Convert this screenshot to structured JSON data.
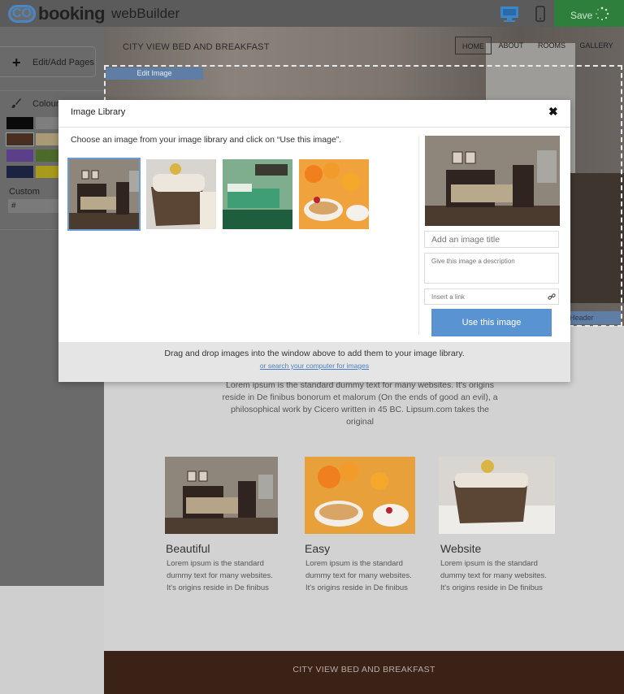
{
  "app": {
    "logo_mark": "CO",
    "logo_word": "booking",
    "logo_product": "webBuilder",
    "save_label": "Save"
  },
  "sidebar": {
    "pages_label": "Edit/Add Pages",
    "colour_label": "Colour",
    "swatches": [
      "#0a0a0a",
      "#7e7e7e",
      "#4a2e20",
      "#a79a74",
      "#5c3f8a",
      "#4c6b2a",
      "#1b2340",
      "#a89a1a"
    ],
    "custom_label": "Custom",
    "custom_value": "#"
  },
  "site": {
    "title": "CITY VIEW BED AND BREAKFAST",
    "nav": [
      "HOME",
      "ABOUT",
      "ROOMS",
      "GALLERY"
    ],
    "edit_image_label": "Edit Image",
    "header_label": "Header",
    "intro": "Lorem ipsum is the standard dummy text for many websites. It's origins reside in De finibus bonorum et malorum (On the ends of good an evil), a philosophical work by Cicero written in 45 BC. Lipsum.com takes the original",
    "cards": [
      {
        "title": "Beautiful",
        "text": "Lorem ipsum is the standard dummy text for many websites. It's origins reside in De finibus"
      },
      {
        "title": "Easy",
        "text": "Lorem ipsum is the standard dummy text for many websites. It's origins reside in De finibus"
      },
      {
        "title": "Website",
        "text": "Lorem ipsum is the standard dummy text for many websites. It's origins reside in De finibus"
      }
    ],
    "footer": "CITY VIEW BED AND BREAKFAST"
  },
  "modal": {
    "title": "Image Library",
    "close": "✖",
    "instruction": "Choose an image from your image library and click on “Use this image”.",
    "images": [
      "bedroom",
      "towel-basket",
      "green-bedroom",
      "breakfast"
    ],
    "title_placeholder": "Add an image title",
    "desc_placeholder": "Give this image a description",
    "link_placeholder": "Insert a link",
    "use_button": "Use this image",
    "drop_text": "Drag and drop images into the window above to add them to your image library.",
    "drop_link": "or search your computer for images"
  },
  "colors": {
    "accent": "#5a93d1",
    "save_green": "#2e7f3c",
    "footer_brown": "#3b2216"
  }
}
